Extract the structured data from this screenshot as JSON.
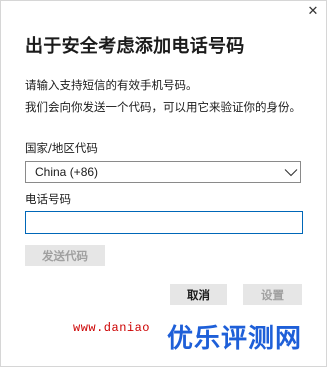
{
  "dialog": {
    "close_glyph": "✕",
    "title": "出于安全考虑添加电话号码",
    "description_1": "请输入支持短信的有效手机号码。",
    "description_2": "我们会向你发送一个代码，可以用它来验证你的身份。"
  },
  "country": {
    "label": "国家/地区代码",
    "selected": "China (+86)",
    "chevron_icon": "chevron-down-icon"
  },
  "phone": {
    "label": "电话号码",
    "value": "",
    "placeholder": ""
  },
  "buttons": {
    "send_code": "发送代码",
    "cancel": "取消",
    "setup": "设置"
  },
  "watermark": {
    "url": "www.daniao",
    "text": "优乐评测网"
  },
  "colors": {
    "accent": "#0067b8",
    "disabled_text": "#a0a0a0",
    "button_bg": "#e6e6e6",
    "watermark_red": "#cc0000",
    "watermark_blue": "#1e5fd8"
  }
}
